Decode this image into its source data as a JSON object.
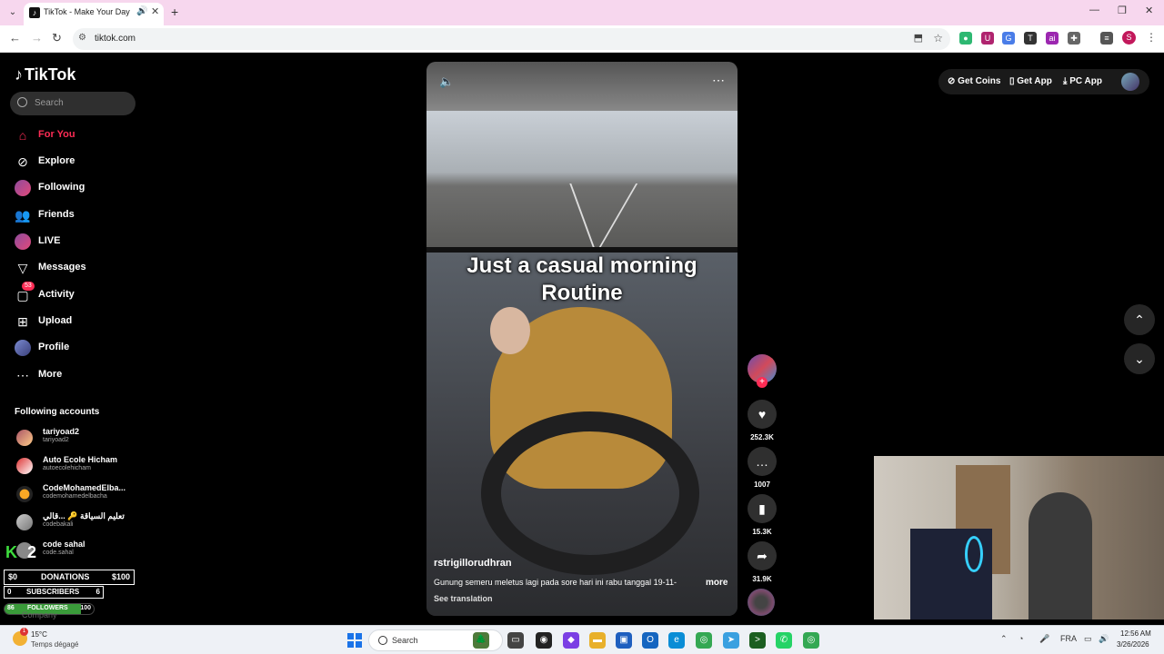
{
  "browser": {
    "tab_title": "TikTok - Make Your Day",
    "url": "tiktok.com"
  },
  "sidebar": {
    "logo": "TikTok",
    "search_placeholder": "Search",
    "nav": [
      {
        "label": "For You",
        "icon": "home-icon"
      },
      {
        "label": "Explore",
        "icon": "compass-icon"
      },
      {
        "label": "Following",
        "icon": "following-avatar"
      },
      {
        "label": "Friends",
        "icon": "friends-icon"
      },
      {
        "label": "LIVE",
        "icon": "live-avatar"
      },
      {
        "label": "Messages",
        "icon": "send-icon"
      },
      {
        "label": "Activity",
        "icon": "activity-icon",
        "badge": "53"
      },
      {
        "label": "Upload",
        "icon": "upload-icon"
      },
      {
        "label": "Profile",
        "icon": "profile-avatar"
      },
      {
        "label": "More",
        "icon": "more-icon"
      }
    ],
    "following_title": "Following accounts",
    "accounts": [
      {
        "name": "tariyoad2",
        "handle": "tariyoad2"
      },
      {
        "name": "Auto Ecole Hicham",
        "handle": "autoecolehicham"
      },
      {
        "name": "CodeMohamedElba...",
        "handle": "codemohamedelbacha"
      },
      {
        "name": "تعليم السياقة 🔑 ...قالي",
        "handle": "codebakali"
      },
      {
        "name": "code sahal",
        "handle": "code.sahal"
      }
    ],
    "company": "Company"
  },
  "stream_overlay": {
    "logo_k": "K",
    "logo_2": "2",
    "donations": {
      "left": "$0",
      "label": "DONATIONS",
      "right": "$100"
    },
    "subscribers": {
      "left": "0",
      "label": "SUBSCRIBERS",
      "right": "6"
    },
    "followers": {
      "left": "86",
      "label": "FOLLOWERS",
      "right": "100",
      "progress": 0.86
    }
  },
  "video": {
    "caption": "Just a casual morning Routine",
    "author": "rstrigillorudhran",
    "description": "Gunung semeru meletus lagi pada sore hari ini rabu tanggal 19-11-",
    "more": "more",
    "see_translation": "See translation"
  },
  "actions": {
    "likes": "252.3K",
    "comments": "1007",
    "saves": "15.3K",
    "shares": "31.9K"
  },
  "topright": {
    "get_coins": "Get Coins",
    "get_app": "Get App",
    "pc_app": "PC App"
  },
  "taskbar": {
    "temperature": "15°C",
    "weather": "Temps dégagé",
    "weather_badge": "1",
    "search_placeholder": "Search",
    "language": "FRA",
    "time": "12:56 AM",
    "date": "3/26/2026"
  }
}
